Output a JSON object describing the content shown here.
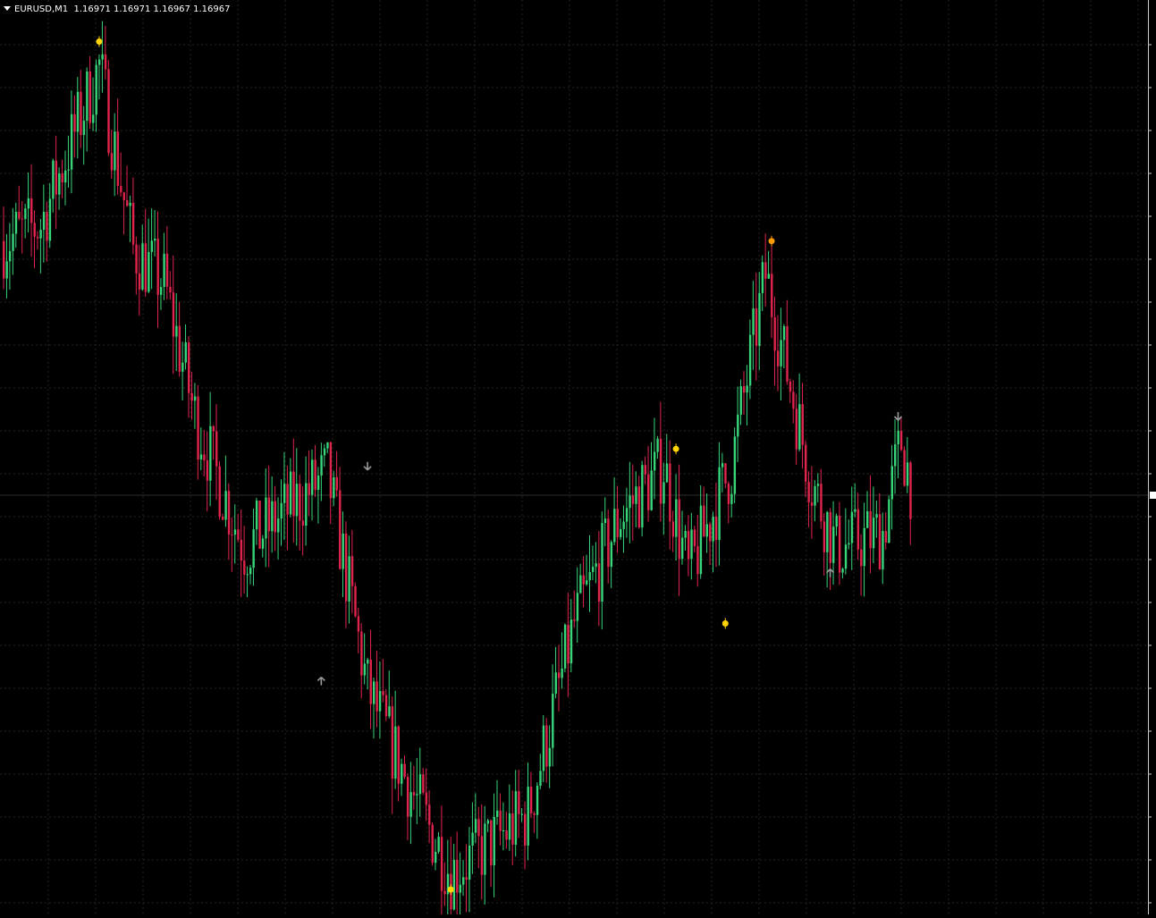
{
  "header": {
    "symbol": "EURUSD,M1",
    "quote": "1.16971 1.16971 1.16967 1.16967"
  },
  "colors": {
    "background": "#000000",
    "grid": "#242424",
    "bull": "#37d67a",
    "bear": "#e0244c",
    "signal_yellow": "#ffd400",
    "signal_gray": "#9a9a9a",
    "axis": "#c8c8c8"
  },
  "chart_data": {
    "type": "candlestick",
    "title": "EURUSD,M1",
    "timeframe": "M1",
    "grid": true,
    "price_axis": "right",
    "ylim": [
      1.164,
      1.175
    ],
    "candles": [],
    "trend_waypoints": [
      {
        "bar": 0,
        "price": 1.1721
      },
      {
        "bar": 12,
        "price": 1.1723
      },
      {
        "bar": 26,
        "price": 1.1737
      },
      {
        "bar": 31,
        "price": 1.1742
      },
      {
        "bar": 42,
        "price": 1.172
      },
      {
        "bar": 52,
        "price": 1.1716
      },
      {
        "bar": 62,
        "price": 1.17
      },
      {
        "bar": 78,
        "price": 1.1684
      },
      {
        "bar": 105,
        "price": 1.1693
      },
      {
        "bar": 118,
        "price": 1.1667
      },
      {
        "bar": 132,
        "price": 1.1655
      },
      {
        "bar": 145,
        "price": 1.1645
      },
      {
        "bar": 170,
        "price": 1.1652
      },
      {
        "bar": 185,
        "price": 1.1675
      },
      {
        "bar": 200,
        "price": 1.1688
      },
      {
        "bar": 214,
        "price": 1.1694
      },
      {
        "bar": 222,
        "price": 1.1681
      },
      {
        "bar": 236,
        "price": 1.1694
      },
      {
        "bar": 247,
        "price": 1.1717
      },
      {
        "bar": 262,
        "price": 1.1692
      },
      {
        "bar": 270,
        "price": 1.1684
      },
      {
        "bar": 285,
        "price": 1.1686
      },
      {
        "bar": 291,
        "price": 1.1697
      },
      {
        "bar": 294,
        "price": 1.1692
      }
    ],
    "signals": [
      {
        "bar": 31,
        "price": 1.1745,
        "kind": "dot",
        "color": "yellow"
      },
      {
        "bar": 118,
        "price": 1.1694,
        "kind": "arrow-down",
        "color": "gray"
      },
      {
        "bar": 103,
        "price": 1.1668,
        "kind": "arrow-up",
        "color": "gray"
      },
      {
        "bar": 145,
        "price": 1.1643,
        "kind": "dot",
        "color": "yellow"
      },
      {
        "bar": 218,
        "price": 1.1696,
        "kind": "dot",
        "color": "yellow"
      },
      {
        "bar": 234,
        "price": 1.1675,
        "kind": "dot",
        "color": "yellow"
      },
      {
        "bar": 249,
        "price": 1.1721,
        "kind": "dot",
        "color": "orange"
      },
      {
        "bar": 268,
        "price": 1.1681,
        "kind": "arrow-up",
        "color": "gray"
      },
      {
        "bar": 290,
        "price": 1.17,
        "kind": "arrow-down",
        "color": "gray"
      }
    ]
  }
}
